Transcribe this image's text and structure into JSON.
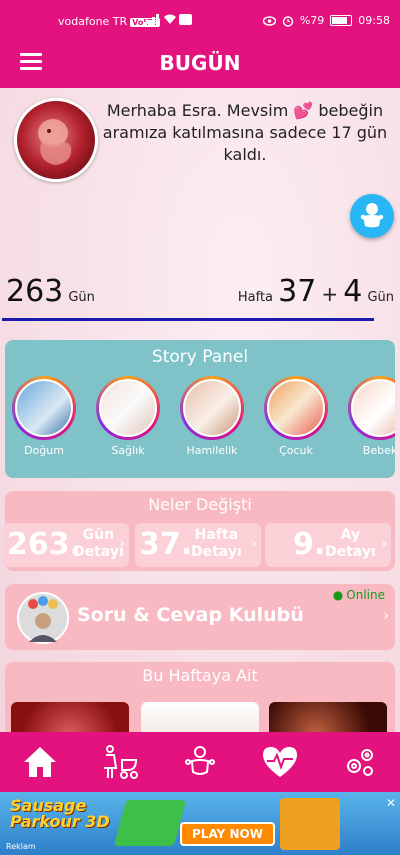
{
  "status_bar": {
    "carrier": "vodafone TR",
    "volte": "VoLTE",
    "battery": "%79",
    "time": "09:58"
  },
  "header": {
    "title": "BUGÜN",
    "menu_icon": "hamburger-menu-icon"
  },
  "greeting": {
    "text": "Merhaba Esra. Mevsim 💕 bebeğin aramıza katılmasına sadece 17 gün kaldı."
  },
  "pregnancy": {
    "days": "263",
    "days_unit": "Gün",
    "week_label": "Hafta",
    "weeks": "37",
    "plus": "+",
    "extra_days": "4",
    "extra_days_unit": "Gün",
    "progress_fraction": 0.94
  },
  "story_panel": {
    "title": "Story Panel",
    "items": [
      {
        "label": "Doğum"
      },
      {
        "label": "Sağlık"
      },
      {
        "label": "Hamilelik"
      },
      {
        "label": "Çocuk"
      },
      {
        "label": "Bebek"
      }
    ]
  },
  "changes": {
    "title": "Neler Değişti",
    "cards": [
      {
        "number": "263.",
        "line1": "Gün",
        "line2": "Detayı"
      },
      {
        "number": "37.",
        "line1": "Hafta",
        "line2": "Detayı"
      },
      {
        "number": "9.",
        "line1": "Ay",
        "line2": "Detayı"
      }
    ]
  },
  "qa": {
    "title": "Soru & Cevap Kulubü",
    "status": "Online"
  },
  "this_week": {
    "title": "Bu Haftaya Ait"
  },
  "bottom_nav": {
    "items": [
      {
        "icon": "home-icon"
      },
      {
        "icon": "mother-stroller-icon"
      },
      {
        "icon": "baby-icon"
      },
      {
        "icon": "heartbeat-icon"
      },
      {
        "icon": "settings-gears-icon"
      }
    ]
  },
  "ad": {
    "logo_line1": "Sausage",
    "logo_line2": "Parkour 3D",
    "cta": "PLAY NOW",
    "label": "Reklam",
    "close": "✕"
  },
  "colors": {
    "primary": "#e3127e",
    "story_panel_bg": "#7fc3c9",
    "card_bg": "#f8b9c3",
    "online": "#1a9a1a",
    "fab": "#29b6f6"
  }
}
